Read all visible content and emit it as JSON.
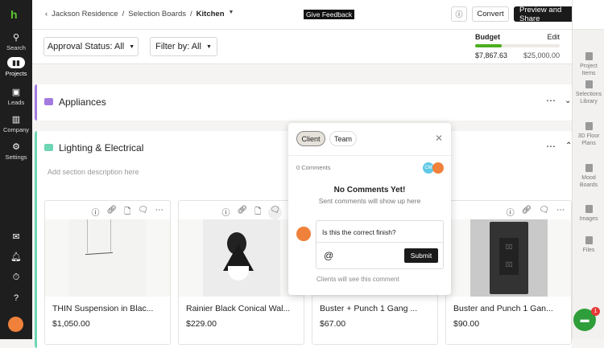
{
  "left_nav": {
    "items": [
      {
        "label": "Search",
        "icon": "search-icon"
      },
      {
        "label": "Projects",
        "icon": "projects-icon"
      },
      {
        "label": "Leads",
        "icon": "leads-icon"
      },
      {
        "label": "Company",
        "icon": "company-icon"
      },
      {
        "label": "Settings",
        "icon": "gear-icon"
      }
    ],
    "bottom_icons": [
      "mail-icon",
      "bell-icon",
      "timer-icon",
      "help-icon"
    ]
  },
  "header": {
    "breadcrumb": [
      "Jackson Residence",
      "Selection Boards",
      "Kitchen"
    ],
    "give_feedback": "Give Feedback",
    "convert": "Convert",
    "preview_share": "Preview and Share"
  },
  "filters": {
    "approval": "Approval Status: All",
    "filter_by": "Filter by: All"
  },
  "budget": {
    "label": "Budget",
    "edit": "Edit",
    "spent": "$7,867.63",
    "total": "$25,000.00",
    "fraction": 0.315,
    "color": "#4caf1f"
  },
  "sections": [
    {
      "title": "Appliances",
      "color": "#a37be0"
    },
    {
      "title": "Lighting & Electrical",
      "color": "#6fd6b5",
      "description_placeholder": "Add section description here"
    }
  ],
  "cards": [
    {
      "name": "THIN Suspension in Blac...",
      "price": "$1,050.00"
    },
    {
      "name": "Rainier Black Conical Wal...",
      "price": "$229.00"
    },
    {
      "name": "Buster + Punch 1 Gang ...",
      "price": "$67.00"
    },
    {
      "name": "Buster and Punch 1 Gan...",
      "price": "$90.00"
    }
  ],
  "comments": {
    "tabs": [
      "Client",
      "Team"
    ],
    "count": "0 Comments",
    "avatar_initials": "CM",
    "empty_title": "No Comments Yet!",
    "empty_sub": "Sent comments will show up here",
    "input_value": "Is this the correct finish?",
    "mention": "@",
    "submit": "Submit",
    "note": "Clients will see this comment"
  },
  "right_nav": {
    "items": [
      "Project Items",
      "Selections Library",
      "3D Floor Plans",
      "Mood Boards",
      "Images",
      "Files"
    ]
  },
  "chat": {
    "badge": "1"
  }
}
